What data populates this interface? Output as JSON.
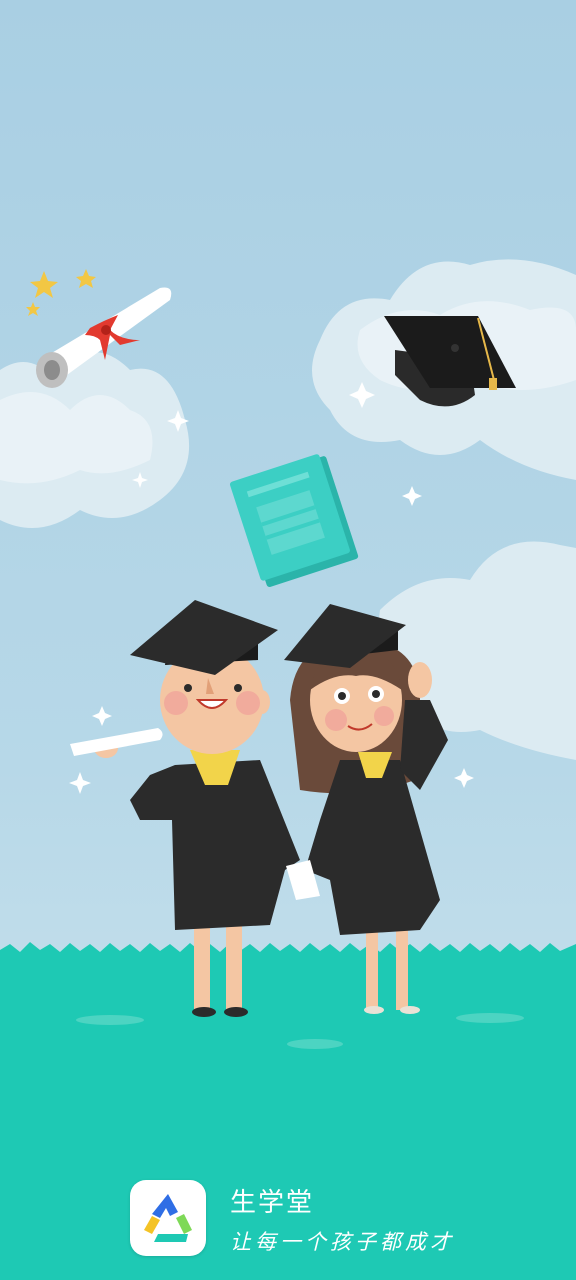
{
  "app": {
    "name": "生学堂",
    "slogan": "让每一个孩子都成才",
    "logo_icon": "triangle-loop-logo-icon"
  },
  "colors": {
    "sky": "#a9cfe3",
    "grass": "#1ec9b4",
    "cloud": "#e6f1f6",
    "gown": "#2b2b2b",
    "book": "#3ccfc4",
    "ribbon": "#e23a2f",
    "star": "#f2c744"
  },
  "illustration": {
    "subjects": [
      "graduation-cap-icon",
      "diploma-scroll-icon",
      "book-icon",
      "graduate-boy",
      "graduate-girl",
      "clouds",
      "sparkle-icon"
    ]
  }
}
